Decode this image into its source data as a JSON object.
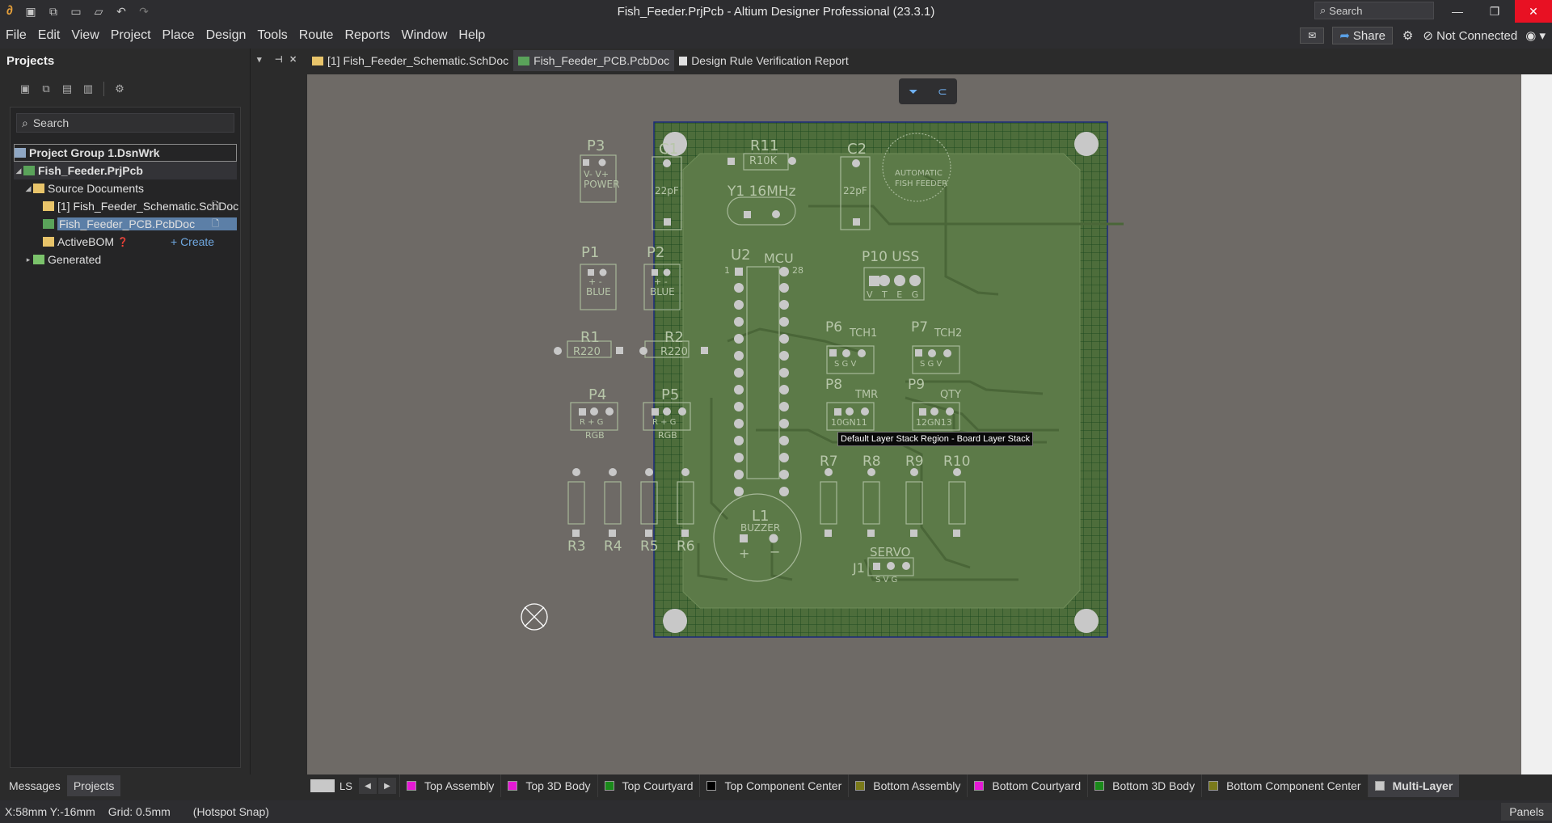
{
  "window": {
    "title": "Fish_Feeder.PrjPcb - Altium Designer Professional (23.3.1)",
    "search_label": "Search"
  },
  "menu": [
    "File",
    "Edit",
    "View",
    "Project",
    "Place",
    "Design",
    "Tools",
    "Route",
    "Reports",
    "Window",
    "Help"
  ],
  "menu_right": {
    "share": "Share",
    "connection": "Not Connected"
  },
  "projects_panel": {
    "title": "Projects",
    "search_placeholder": "Search",
    "group": "Project Group 1.DsnWrk",
    "project": "Fish_Feeder.PrjPcb",
    "source_folder": "Source Documents",
    "schematic": "[1] Fish_Feeder_Schematic.SchDoc",
    "pcb": "Fish_Feeder_PCB.PcbDoc",
    "activebom": "ActiveBOM",
    "create": "+ Create",
    "generated": "Generated"
  },
  "doc_tabs": [
    {
      "label": "[1] Fish_Feeder_Schematic.SchDoc",
      "active": false
    },
    {
      "label": "Fish_Feeder_PCB.PcbDoc",
      "active": true
    },
    {
      "label": "Design Rule Verification Report",
      "active": false
    }
  ],
  "tooltip": "Default Layer Stack Region - Board Layer Stack",
  "pcb_labels": {
    "P3": "P3",
    "C1": "C1",
    "R11": "R11",
    "C2": "C2",
    "R10K": "R10K",
    "pf": "22pF",
    "Y1": "Y1 16MHz",
    "power": "V- V+",
    "power2": "POWER",
    "logo1": "AUTOMATIC",
    "logo2": "FISH FEEDER",
    "P1": "P1",
    "P2": "P2",
    "U2": "U2",
    "MCU": "MCU",
    "pin1": "1",
    "pin28": "28",
    "P10": "P10 USS",
    "vteg": "V T E G",
    "blue": "BLUE",
    "pm": "+ -",
    "R1": "R1",
    "R2": "R2",
    "R220": "R220",
    "P6": "P6",
    "TCH1": "TCH1",
    "P7": "P7",
    "TCH2": "TCH2",
    "sgv": "S G V",
    "P4": "P4",
    "P5": "P5",
    "P8": "P8",
    "TMR": "TMR",
    "P9": "P9",
    "QTY": "QTY",
    "rpg": "R + G",
    "RGB": "RGB",
    "gn11": "10GN11",
    "gn13": "12GN13",
    "R7": "R7",
    "R8": "R8",
    "R9": "R9",
    "R10": "R10",
    "R3": "R3",
    "R4": "R4",
    "R5": "R5",
    "R6": "R6",
    "L1": "L1",
    "BUZZER": "BUZZER",
    "plus": "+",
    "minus": "−",
    "SERVO": "SERVO",
    "J1": "J1",
    "svg": "S V G"
  },
  "bottom_tabs": [
    "Messages",
    "Projects"
  ],
  "layers": {
    "ls": "LS",
    "items": [
      {
        "label": "Top Assembly",
        "color": "#e619d6"
      },
      {
        "label": "Top 3D Body",
        "color": "#e619d6"
      },
      {
        "label": "Top Courtyard",
        "color": "#1a8a1a"
      },
      {
        "label": "Top Component Center",
        "color": "#000000"
      },
      {
        "label": "Bottom Assembly",
        "color": "#7a7a1a"
      },
      {
        "label": "Bottom Courtyard",
        "color": "#e619d6"
      },
      {
        "label": "Bottom 3D Body",
        "color": "#1a8a1a"
      },
      {
        "label": "Bottom Component Center",
        "color": "#7a7a1a"
      },
      {
        "label": "Multi-Layer",
        "color": "#c8c8c8"
      }
    ]
  },
  "status": {
    "coords": "X:58mm Y:-16mm",
    "grid": "Grid: 0.5mm",
    "snap": "(Hotspot Snap)",
    "panels": "Panels"
  }
}
